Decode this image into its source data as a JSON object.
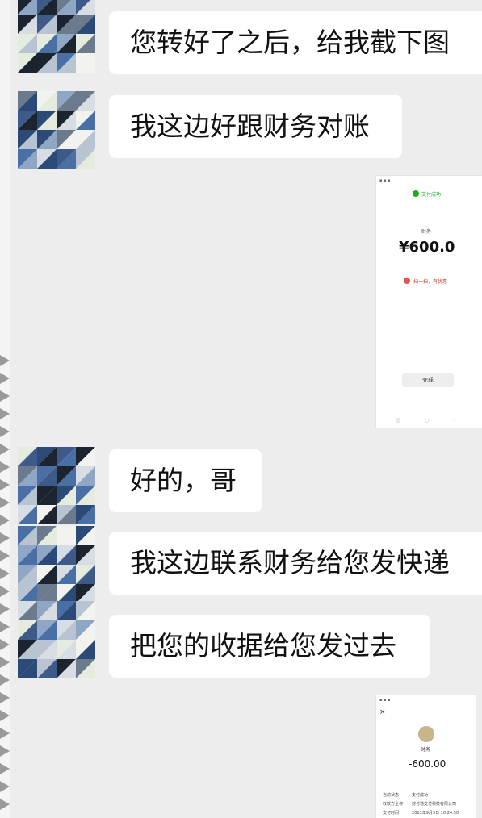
{
  "messages": [
    {
      "text": "您转好了之后，给我截下图"
    },
    {
      "text": "我这边好跟财务对账"
    },
    {
      "text": "好的，哥"
    },
    {
      "text": "我这边联系财务给您发快递"
    },
    {
      "text": "把您的收据给您发过去"
    }
  ],
  "screenshot1": {
    "status": "支付成功",
    "payee": "财务",
    "amount": "¥600.0",
    "promo": "扫一扫，有优惠",
    "done_button": "完成"
  },
  "screenshot2": {
    "payee": "财务",
    "amount": "-600.00",
    "rows": [
      {
        "label": "当前状态",
        "value": "支付成功"
      },
      {
        "label": "收款方全称",
        "value": "财付通支付科技有限公司"
      },
      {
        "label": "支付时间",
        "value": "2023年9月3日 10:24:50"
      }
    ]
  },
  "colors": {
    "background": "#ededed",
    "bubble": "#ffffff",
    "success_green": "#1aad19"
  },
  "icons": [
    "mosaic-avatar-icon",
    "check-circle-icon",
    "close-icon"
  ]
}
